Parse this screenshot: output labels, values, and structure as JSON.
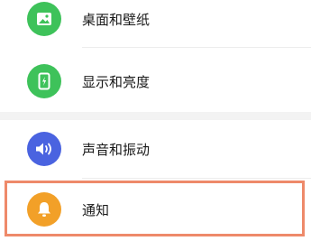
{
  "settings": {
    "items": [
      {
        "label": "桌面和壁纸",
        "icon": "wallpaper-icon",
        "color": "#3ec25a"
      },
      {
        "label": "显示和亮度",
        "icon": "display-brightness-icon",
        "color": "#3ec25a"
      },
      {
        "label": "声音和振动",
        "icon": "sound-icon",
        "color": "#4a63e0"
      },
      {
        "label": "通知",
        "icon": "bell-icon",
        "color": "#f2a028"
      }
    ]
  },
  "highlight": {
    "target": "通知",
    "color": "#ee8a6a"
  }
}
